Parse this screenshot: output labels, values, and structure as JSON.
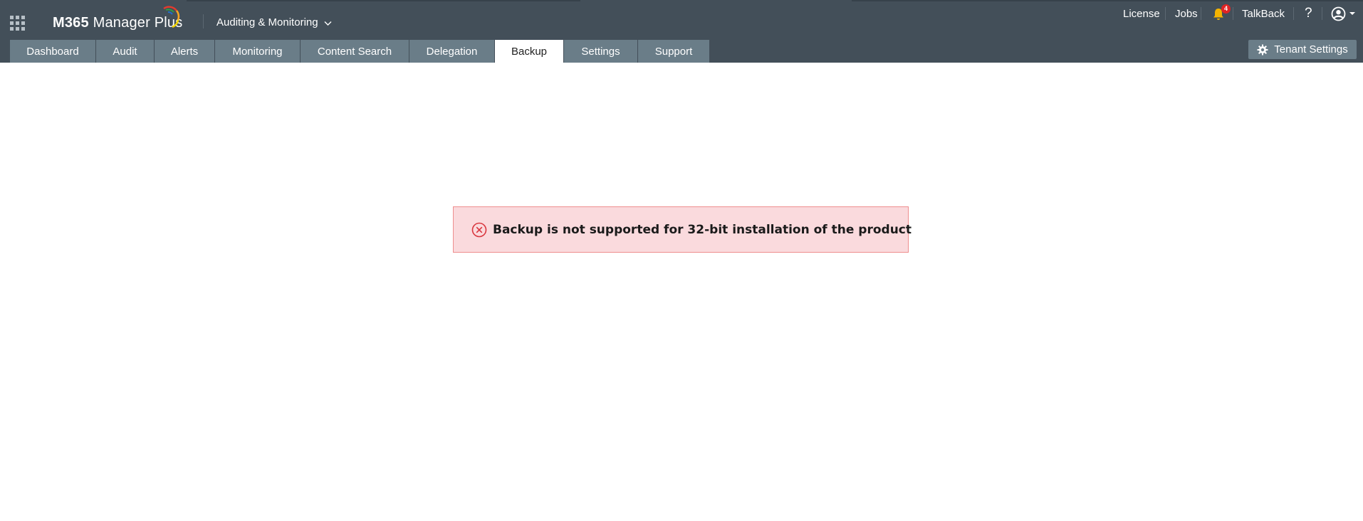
{
  "app": {
    "brand_prefix": "M365",
    "brand_suffix": "Manager Plus",
    "module": "Auditing & Monitoring"
  },
  "top_links": {
    "license": "License",
    "jobs": "Jobs",
    "notification_count": "4",
    "talkback": "TalkBack",
    "help": "?"
  },
  "tabs": [
    {
      "label": "Dashboard"
    },
    {
      "label": "Audit"
    },
    {
      "label": "Alerts"
    },
    {
      "label": "Monitoring"
    },
    {
      "label": "Content Search"
    },
    {
      "label": "Delegation"
    },
    {
      "label": "Backup",
      "active": true
    },
    {
      "label": "Settings"
    },
    {
      "label": "Support"
    }
  ],
  "tenant_settings": "Tenant Settings",
  "message": {
    "text": "Backup is not supported for 32-bit installation of the product",
    "type": "error"
  },
  "colors": {
    "header_bg": "#434f59",
    "tab_bg": "#6a7d88",
    "active_tab_bg": "#ffffff",
    "error_bg": "#fadadd",
    "error_border": "#ee8e8e",
    "error_icon": "#d9363e",
    "badge": "#e02424",
    "bell": "#f5b400"
  }
}
